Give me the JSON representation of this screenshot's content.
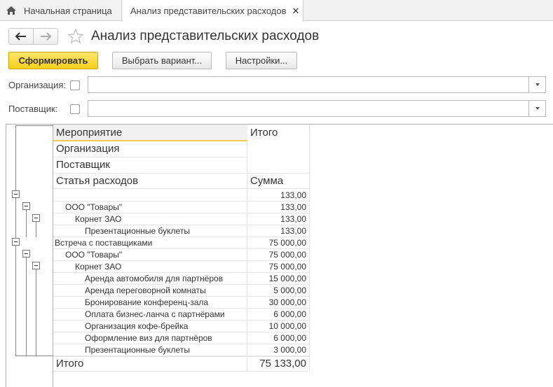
{
  "tabs": {
    "home_label": "Начальная страница",
    "active_label": "Анализ представительских расходов",
    "close_glyph": "✕"
  },
  "header": {
    "back_glyph": "🡐",
    "forward_glyph": "🡒",
    "title": "Анализ представительских расходов"
  },
  "toolbar": {
    "generate_label": "Сформировать",
    "variant_label": "Выбрать вариант...",
    "settings_label": "Настройки..."
  },
  "filters": {
    "organization_label": "Организация:",
    "organization_value": "",
    "supplier_label": "Поставщик:",
    "supplier_value": ""
  },
  "report": {
    "headers": {
      "event": "Мероприятие",
      "organization": "Организация",
      "supplier": "Поставщик",
      "expense_item": "Статья расходов",
      "total": "Итого",
      "sum": "Сумма"
    },
    "rows": [
      {
        "label": "",
        "value": "133,00"
      },
      {
        "label": "ООО \"Товары\"",
        "value": "133,00"
      },
      {
        "label": "Корнет ЗАО",
        "value": "133,00"
      },
      {
        "label": "Презентационные буклеты",
        "value": "133,00"
      },
      {
        "label": "Встреча с поставщиками",
        "value": "75 000,00"
      },
      {
        "label": "ООО \"Товары\"",
        "value": "75 000,00"
      },
      {
        "label": "Корнет ЗАО",
        "value": "75 000,00"
      },
      {
        "label": "Аренда автомобиля для партнёров",
        "value": "15 000,00"
      },
      {
        "label": "Аренда переговорной комнаты",
        "value": "5 000,00"
      },
      {
        "label": "Бронирование конференц-зала",
        "value": "30 000,00"
      },
      {
        "label": "Оплата бизнес-ланча с партнёрами",
        "value": "6 000,00"
      },
      {
        "label": "Организация кофе-брейка",
        "value": "10 000,00"
      },
      {
        "label": "Оформление виз для партнёров",
        "value": "6 000,00"
      },
      {
        "label": "Презентационные буклеты",
        "value": "3 000,00"
      }
    ],
    "grand_total_label": "Итого",
    "grand_total_value": "75 133,00"
  }
}
